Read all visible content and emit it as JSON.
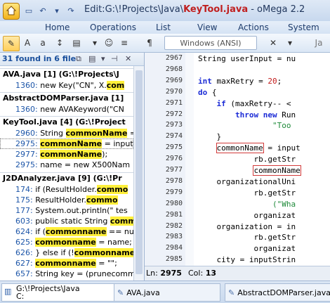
{
  "title": {
    "prefix": "Edit:",
    "path": "G:\\!Projects\\Java\\",
    "file": "KeyTool.java",
    "app": "- oMega 2.2"
  },
  "menu": [
    "Home",
    "Operations",
    "List",
    "View",
    "Actions",
    "System"
  ],
  "toolbar": {
    "encoding": "Windows (ANSI)",
    "pilcrow": "¶",
    "ja_label": "Ja"
  },
  "results": {
    "count_label": "31 found in 6 file",
    "groups": [
      {
        "header": "AVA.java [1]  (G:\\!Projects\\J",
        "lines": [
          {
            "num": "1360:",
            "pre": "new Key(\"CN\",     X.",
            "hl": "com"
          }
        ]
      },
      {
        "header": "AbstractDOMParser.java [1]",
        "lines": [
          {
            "num": "1360:",
            "pre": "new AVAKeyword(\"CN",
            "hl": ""
          }
        ]
      },
      {
        "header": "KeyTool.java [4]  (G:\\!Project",
        "lines": [
          {
            "num": "2960:",
            "pre": "String ",
            "hl": "commonName",
            "post": " ="
          },
          {
            "num": "2975:",
            "pre": "",
            "hl": "commonName",
            "post": " = input"
          },
          {
            "num": "2977:",
            "pre": "",
            "hl": "commonName",
            "post": ");"
          },
          {
            "num": "2975:",
            "pre": "name = new X500Nam",
            "hl": "",
            "post": ""
          }
        ]
      },
      {
        "header": "J2DAnalyzer.java [9]  (G:\\!Pr",
        "lines": [
          {
            "num": "174:",
            "pre": "if (ResultHolder.",
            "hl": "commo",
            "post": ""
          },
          {
            "num": "175:",
            "pre": "ResultHolder.",
            "hl": "commo",
            "post": ""
          },
          {
            "num": "177:",
            "pre": "System.out.println(\"  tes",
            "hl": "",
            "post": ""
          },
          {
            "num": "603:",
            "pre": "public static String ",
            "hl": "comm",
            "post": ""
          },
          {
            "num": "624:",
            "pre": "if (",
            "hl": "commonname",
            "post": " == nu"
          },
          {
            "num": "625:",
            "pre": "",
            "hl": "commonname",
            "post": " = name;"
          },
          {
            "num": "626:",
            "pre": "} else if (!",
            "hl": "commonname",
            "post": ""
          },
          {
            "num": "627:",
            "pre": "",
            "hl": "commonname",
            "post": " = \"\";"
          },
          {
            "num": "657:",
            "pre": "String key = (prunecomm",
            "hl": "",
            "post": ""
          }
        ]
      }
    ]
  },
  "editor": {
    "line_numbers": [
      "2967",
      "2968",
      "2969",
      "2970",
      "2971",
      "2972",
      "2973",
      "2974",
      "2975",
      "2976",
      "2977",
      "2978",
      "2979",
      "2980",
      "2981",
      "2982",
      "2983",
      "2984",
      "2985"
    ],
    "lines": [
      [
        {
          "t": "String userInput = nu",
          "c": ""
        }
      ],
      [],
      [
        {
          "t": "int",
          "c": "kw"
        },
        {
          "t": " maxRetry = ",
          "c": ""
        },
        {
          "t": "20",
          "c": "num"
        },
        {
          "t": ";",
          "c": ""
        }
      ],
      [
        {
          "t": "do",
          "c": "kw"
        },
        {
          "t": " {",
          "c": ""
        }
      ],
      [
        {
          "t": "    ",
          "c": ""
        },
        {
          "t": "if",
          "c": "kw"
        },
        {
          "t": " (maxRetry-- < ",
          "c": ""
        }
      ],
      [
        {
          "t": "        ",
          "c": ""
        },
        {
          "t": "throw new",
          "c": "kw"
        },
        {
          "t": " Run",
          "c": ""
        }
      ],
      [
        {
          "t": "                ",
          "c": ""
        },
        {
          "t": "\"Too",
          "c": "str"
        }
      ],
      [
        {
          "t": "    }",
          "c": ""
        }
      ],
      [
        {
          "t": "    ",
          "c": ""
        },
        {
          "t": "commonName",
          "c": "boxed"
        },
        {
          "t": " = input",
          "c": ""
        }
      ],
      [
        {
          "t": "            rb.getStr",
          "c": ""
        }
      ],
      [
        {
          "t": "            ",
          "c": ""
        },
        {
          "t": "commonName",
          "c": "boxed"
        }
      ],
      [
        {
          "t": "    organizationalUni",
          "c": ""
        }
      ],
      [
        {
          "t": "            rb.getStr",
          "c": ""
        }
      ],
      [
        {
          "t": "                (\"Wha",
          "c": "str"
        }
      ],
      [
        {
          "t": "            organizat",
          "c": ""
        }
      ],
      [
        {
          "t": "    organization = in",
          "c": ""
        }
      ],
      [
        {
          "t": "            rb.getStr",
          "c": ""
        }
      ],
      [
        {
          "t": "            organizat",
          "c": ""
        }
      ],
      [
        {
          "t": "    city = inputStrin",
          "c": ""
        }
      ]
    ]
  },
  "status": {
    "ln_label": "Ln:",
    "ln": "2975",
    "col_label": "Col:",
    "col": "13"
  },
  "tabs": [
    {
      "label": "G:\\!Projects\\Java",
      "sub": "C:"
    },
    {
      "label": "AVA.java"
    },
    {
      "label": "AbstractDOMParser.java"
    }
  ]
}
